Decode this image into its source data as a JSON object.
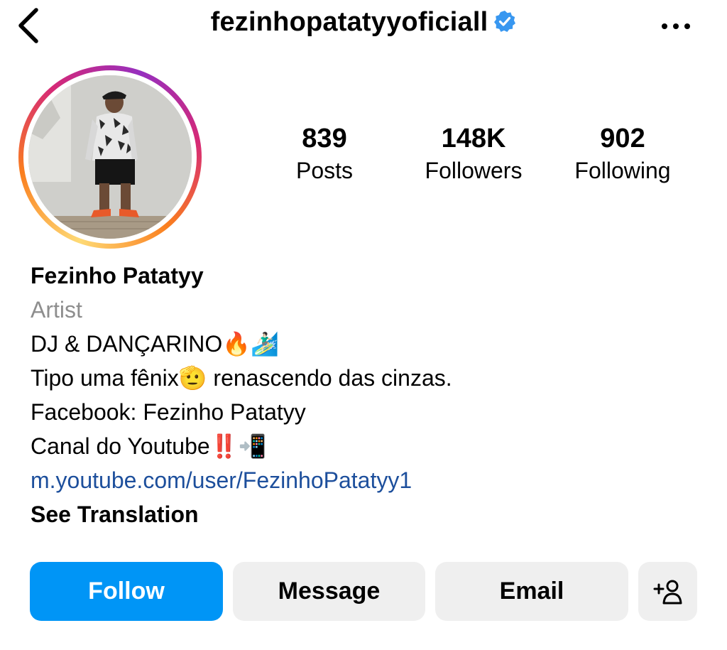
{
  "header": {
    "username": "fezinhopatatyyoficiall",
    "verified": true,
    "back_icon": "chevron-left-icon",
    "more_icon": "more-horizontal-icon"
  },
  "profile": {
    "avatar_alt": "profile-photo",
    "story_ring": true
  },
  "stats": {
    "posts_count": "839",
    "posts_label": "Posts",
    "followers_count": "148K",
    "followers_label": "Followers",
    "following_count": "902",
    "following_label": "Following"
  },
  "bio": {
    "name": "Fezinho Patatyy",
    "category": "Artist",
    "line1": "DJ & DANÇARINO🔥🏄🏻‍♂️",
    "line2": "Tipo uma fênix🫡 renascendo das cinzas.",
    "line3": "Facebook: Fezinho Patatyy",
    "line4": "Canal do Youtube‼️📲",
    "link": "m.youtube.com/user/FezinhoPatatyy1",
    "see_translation": "See Translation"
  },
  "actions": {
    "follow": "Follow",
    "message": "Message",
    "email": "Email",
    "suggest_icon": "add-person-icon"
  },
  "colors": {
    "follow_blue": "#0095f6",
    "secondary_button": "#efefef",
    "link": "#1d4f9c",
    "muted_text": "#8e8e8e",
    "verified_blue": "#3897f0"
  }
}
